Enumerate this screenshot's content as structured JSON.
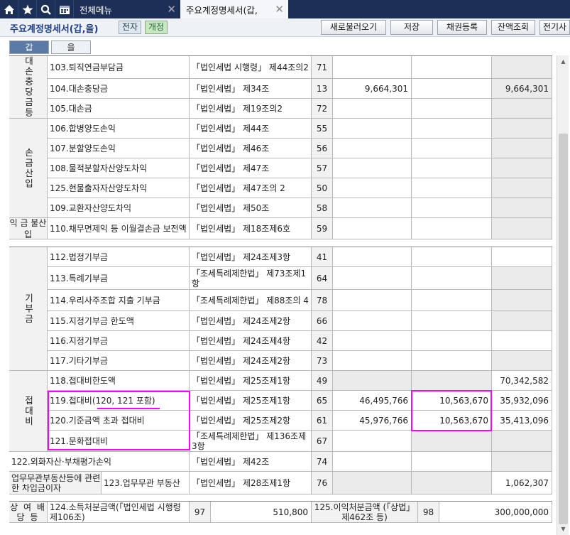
{
  "topbar": {
    "tabs": [
      {
        "label": "전체메뉴",
        "active": false
      },
      {
        "label": "주요계정명세서(갑,",
        "active": true
      }
    ],
    "icons": [
      "home-icon",
      "star-icon",
      "search-icon",
      "calendar-icon",
      "close-icon"
    ]
  },
  "header": {
    "title": "주요계정명세서(갑,을)",
    "badges": [
      "전자",
      "개정"
    ],
    "buttons": [
      "새로불러오기",
      "저장",
      "채권등록",
      "잔액조회",
      "전기사"
    ]
  },
  "subtabs": [
    "갑",
    "을"
  ],
  "groups": {
    "daesoon": "대손충당금등",
    "sonkeum": "손금산입",
    "ikkeum": "익 금 불산입",
    "gibu": "기부금",
    "jeopdae": "접대비",
    "sangyeo": "상 여 배당 등"
  },
  "rows": [
    {
      "label": "103.퇴직연금부담금",
      "law": "「법인세법 시행령」 제44조의2",
      "code": "71",
      "c1": "",
      "c2": "",
      "c3": ""
    },
    {
      "label": "104.대손충당금",
      "law": "「법인세법」 제34조",
      "code": "13",
      "c1": "9,664,301",
      "c2": "",
      "c3": "9,664,301"
    },
    {
      "label": "105.대손금",
      "law": "「법인세법」 제19조의2",
      "code": "72",
      "c1": "",
      "c2": "",
      "c3": ""
    },
    {
      "label": "106.합병양도손익",
      "law": "「법인세법」 제44조",
      "code": "55",
      "c1": "",
      "c2": "",
      "c3": ""
    },
    {
      "label": "107.분할양도손익",
      "law": "「법인세법」 제46조",
      "code": "56",
      "c1": "",
      "c2": "",
      "c3": ""
    },
    {
      "label": "108.물적분할자산양도차익",
      "law": "「법인세법」 제47조",
      "code": "57",
      "c1": "",
      "c2": "",
      "c3": ""
    },
    {
      "label": "125.현물출자자산양도차익",
      "law": "「법인세법」 제47조의 2",
      "code": "50",
      "c1": "",
      "c2": "",
      "c3": ""
    },
    {
      "label": "109.교환자산양도차익",
      "law": "「법인세법」 제50조",
      "code": "58",
      "c1": "",
      "c2": "",
      "c3": ""
    },
    {
      "label": "110.채무면제익 등 이월결손금 보전액",
      "law": "「법인세법」 제18조제6호",
      "code": "59",
      "c1": "",
      "c2": "",
      "c3": ""
    },
    {
      "label": "112.법정기부금",
      "law": "「법인세법」 제24조제3항",
      "code": "41",
      "c1": "",
      "c2": "",
      "c3": ""
    },
    {
      "label": "113.특례기부금",
      "law": "「조세특례제한법」 제73조제1항",
      "code": "64",
      "c1": "",
      "c2": "",
      "c3": ""
    },
    {
      "label": "114.우리사주조합 지출 기부금",
      "law": "「조세특례제한법」 제88조의 4",
      "code": "78",
      "c1": "",
      "c2": "",
      "c3": ""
    },
    {
      "label": "115.지정기부금 한도액",
      "law": "「법인세법」 제24조제2항",
      "code": "66",
      "c1": "",
      "c2": "",
      "c3": ""
    },
    {
      "label": "116.지정기부금",
      "law": "「법인세법」 제24조제4항",
      "code": "42",
      "c1": "",
      "c2": "",
      "c3": ""
    },
    {
      "label": "117.기타기부금",
      "law": "「법인세법」 제24조제2항",
      "code": "73",
      "c1": "",
      "c2": "",
      "c3": ""
    },
    {
      "label": "118.접대비한도액",
      "law": "「법인세법」 제25조제1항",
      "code": "49",
      "c1": "",
      "c2": "",
      "c3": "70,342,582"
    },
    {
      "label": "119.접대비(120, 121 포함)",
      "law": "「법인세법」 제25조제1항",
      "code": "65",
      "c1": "46,495,766",
      "c2": "10,563,670",
      "c3": "35,932,096"
    },
    {
      "label": "120.기준금액 초과 접대비",
      "law": "「법인세법」 제25조제2항",
      "code": "61",
      "c1": "45,976,766",
      "c2": "10,563,670",
      "c3": "35,413,096"
    },
    {
      "label": "121.문화접대비",
      "law": "「조세특례제한법」 제136조제3항",
      "code": "67",
      "c1": "",
      "c2": "",
      "c3": ""
    },
    {
      "label": "122.외화자산·부채평가손익",
      "law": "「법인세법」 제42조",
      "code": "74",
      "c1": "",
      "c2": "",
      "c3": ""
    },
    {
      "label": "업무무관부동산등에 관련한 차입금이자",
      "sublabel": "123.업무무관 부동산",
      "law": "「법인세법」 제28조제1항",
      "code": "76",
      "c1": "",
      "c2": "",
      "c3": "1,062,307"
    }
  ],
  "footer": {
    "label": "124.소득처분금액(「법인세법 시행령 제106조)",
    "code": "97",
    "amount": "510,800",
    "label2": "125.이익처분금액 (「상법」 제462조 등)",
    "code2": "98",
    "amount2": "300,000,000"
  }
}
